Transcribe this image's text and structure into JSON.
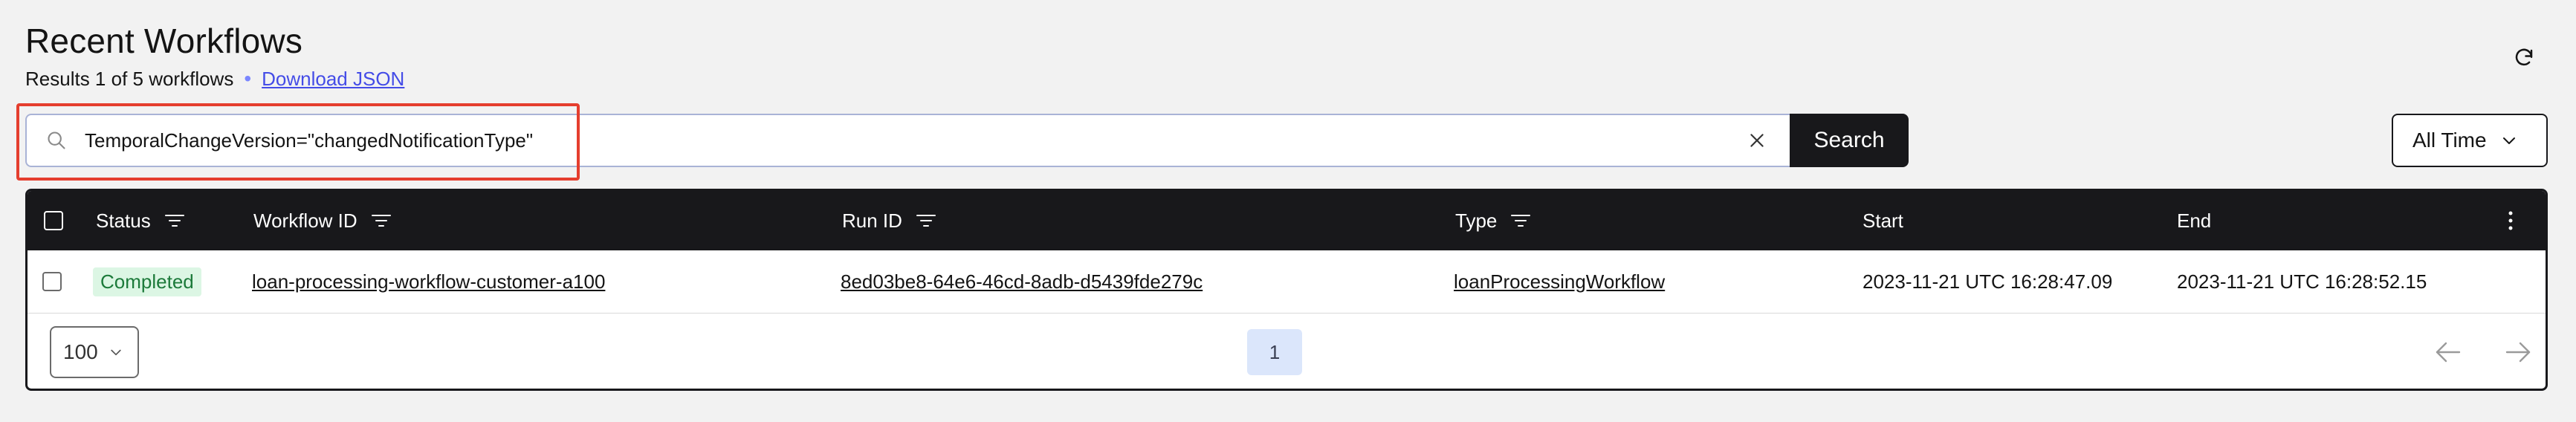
{
  "header": {
    "title": "Recent Workflows",
    "results_text": "Results 1 of 5 workflows",
    "separator": "•",
    "download_label": "Download JSON",
    "refresh_icon": "refresh-icon"
  },
  "search": {
    "query": "TemporalChangeVersion=\"changedNotificationType\"",
    "button_label": "Search",
    "search_icon": "search-icon",
    "clear_icon": "close-icon"
  },
  "time_filter": {
    "selected": "All Time"
  },
  "table": {
    "columns": {
      "status": "Status",
      "workflow_id": "Workflow ID",
      "run_id": "Run ID",
      "type": "Type",
      "start": "Start",
      "end": "End"
    },
    "rows": [
      {
        "status": "Completed",
        "workflow_id": "loan-processing-workflow-customer-a100",
        "run_id": "8ed03be8-64e6-46cd-8adb-d5439fde279c",
        "type": "loanProcessingWorkflow",
        "start": "2023-11-21 UTC 16:28:47.09",
        "end": "2023-11-21 UTC 16:28:52.15"
      }
    ]
  },
  "pagination": {
    "page_size": "100",
    "current_page": "1"
  },
  "colors": {
    "header_bg": "#18181b",
    "accent_link": "#444ce7",
    "status_completed_bg": "#dcf6e4",
    "status_completed_text": "#1c7a3a",
    "highlight": "#e53e2e",
    "page_active_bg": "#dbe6fb"
  }
}
